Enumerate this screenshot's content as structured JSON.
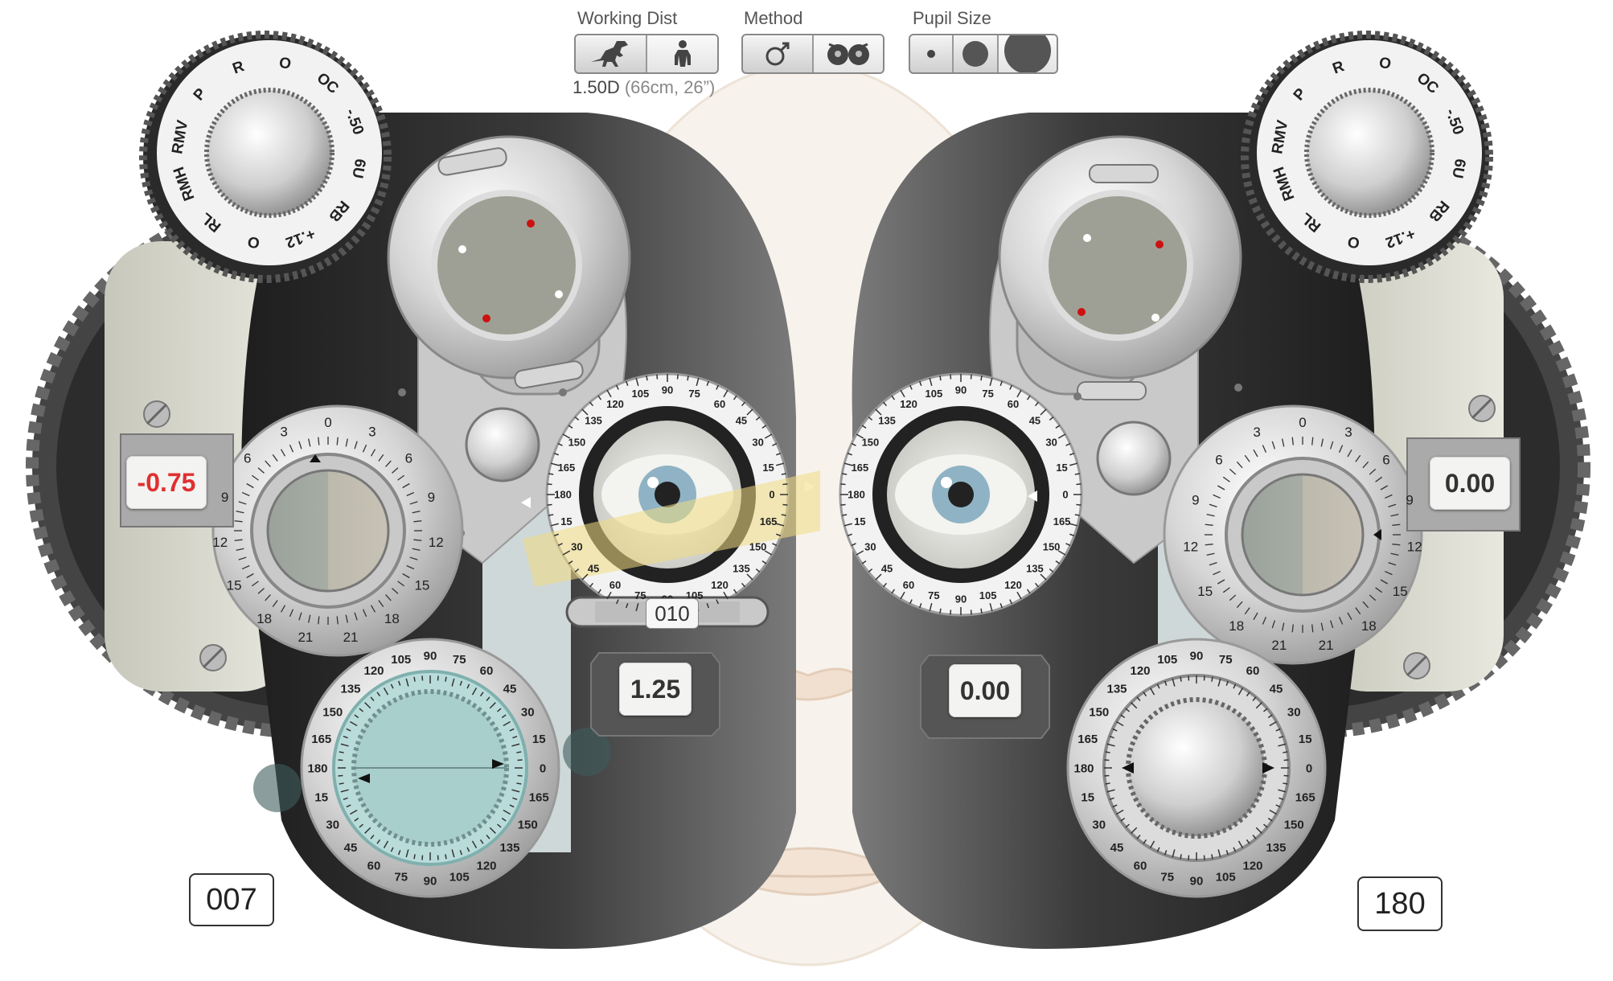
{
  "toolbar": {
    "working_distance": {
      "label": "Working Dist",
      "options": [
        {
          "icon": "dinosaur-icon"
        },
        {
          "icon": "person-icon"
        }
      ],
      "value_main": "1.50D",
      "value_detail": "(66cm, 26”)"
    },
    "method": {
      "label": "Method",
      "options": [
        {
          "icon": "retinoscope-icon"
        },
        {
          "icon": "owl-eyes-icon"
        }
      ]
    },
    "pupil_size": {
      "label": "Pupil Size",
      "options": [
        {
          "icon": "pupil-small-icon"
        },
        {
          "icon": "pupil-medium-icon"
        },
        {
          "icon": "pupil-large-icon"
        }
      ]
    }
  },
  "left_eye": {
    "sphere": "-0.75",
    "cylinder": "1.25",
    "axis": "007",
    "aux_dial_labels": [
      "O",
      "OC",
      "-.50",
      "6U",
      "RB",
      "+.12",
      "O",
      "RL",
      "RMH",
      "RMV",
      "P",
      "R"
    ]
  },
  "right_eye": {
    "sphere": "0.00",
    "cylinder": "0.00",
    "axis": "180",
    "aux_dial_labels": [
      "O",
      "OC",
      "-.50",
      "6U",
      "RB",
      "+.12",
      "O",
      "RL",
      "RMH",
      "RMV",
      "P",
      "R"
    ]
  },
  "pd": {
    "value": "010"
  },
  "axis_scale": [
    {
      "deg": 0,
      "label": "0"
    },
    {
      "deg": 15,
      "label": "15"
    },
    {
      "deg": 30,
      "label": "30"
    },
    {
      "deg": 45,
      "label": "45"
    },
    {
      "deg": 60,
      "label": "60"
    },
    {
      "deg": 75,
      "label": "75"
    },
    {
      "deg": 90,
      "label": "90"
    },
    {
      "deg": 105,
      "label": "105"
    },
    {
      "deg": 120,
      "label": "120"
    },
    {
      "deg": 135,
      "label": "135"
    },
    {
      "deg": 150,
      "label": "150"
    },
    {
      "deg": 165,
      "label": "165"
    },
    {
      "deg": 180,
      "label": "180"
    },
    {
      "deg": 195,
      "label": "15"
    },
    {
      "deg": 210,
      "label": "30"
    },
    {
      "deg": 225,
      "label": "45"
    },
    {
      "deg": 240,
      "label": "60"
    },
    {
      "deg": 255,
      "label": "75"
    },
    {
      "deg": 270,
      "label": "90"
    },
    {
      "deg": 285,
      "label": "105"
    },
    {
      "deg": 300,
      "label": "120"
    },
    {
      "deg": 315,
      "label": "135"
    },
    {
      "deg": 330,
      "label": "150"
    },
    {
      "deg": 345,
      "label": "165"
    }
  ],
  "prism_scale_labels": [
    "0",
    "3",
    "6",
    "9",
    "12",
    "15",
    "18",
    "21",
    "21",
    "18",
    "15",
    "12",
    "9",
    "6",
    "3"
  ],
  "colors": {
    "housing": "#2a2a2a",
    "metal": "#d9d9d9",
    "sphere_negative": "#e03030",
    "lens_tint": "#9fa095"
  }
}
